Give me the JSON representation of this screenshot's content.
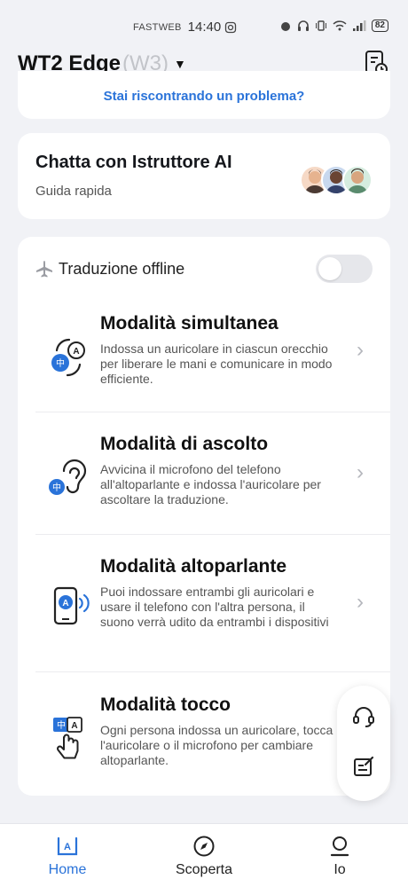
{
  "status_bar": {
    "carrier": "FASTWEB",
    "time": "14:40",
    "battery": "82"
  },
  "header": {
    "device_name": "WT2 Edge",
    "device_model": "(W3)",
    "icon": "device-settings-icon"
  },
  "problem_banner": {
    "link_text": "Stai riscontrando un problema?"
  },
  "ai_card": {
    "title": "Chatta con Istruttore AI",
    "subtitle": "Guida rapida"
  },
  "offline": {
    "label": "Traduzione offline",
    "enabled": false
  },
  "modes": [
    {
      "title": "Modalità simultanea",
      "description": "Indossa un auricolare in ciascun orecchio per liberare le mani e comunicare in modo efficiente.",
      "icon": "simultaneous-icon"
    },
    {
      "title": "Modalità di ascolto",
      "description": "Avvicina il microfono del telefono all'altoparlante e indossa l'auricolare per ascoltare la traduzione.",
      "icon": "ear-icon"
    },
    {
      "title": "Modalità altoparlante",
      "description": "Puoi indossare entrambi gli auricolari e usare il telefono con l'altra persona, il suono verrà udito da entrambi i dispositivi",
      "icon": "phone-speaker-icon"
    },
    {
      "title": "Modalità tocco",
      "description": "Ogni persona indossa un auricolare, tocca l'auricolare o il microfono per cambiare altoparlante.",
      "icon": "touch-icon"
    }
  ],
  "nav": {
    "home": "Home",
    "discover": "Scoperta",
    "me": "Io"
  },
  "colors": {
    "accent": "#2a73d9",
    "background": "#f1f2f6"
  }
}
